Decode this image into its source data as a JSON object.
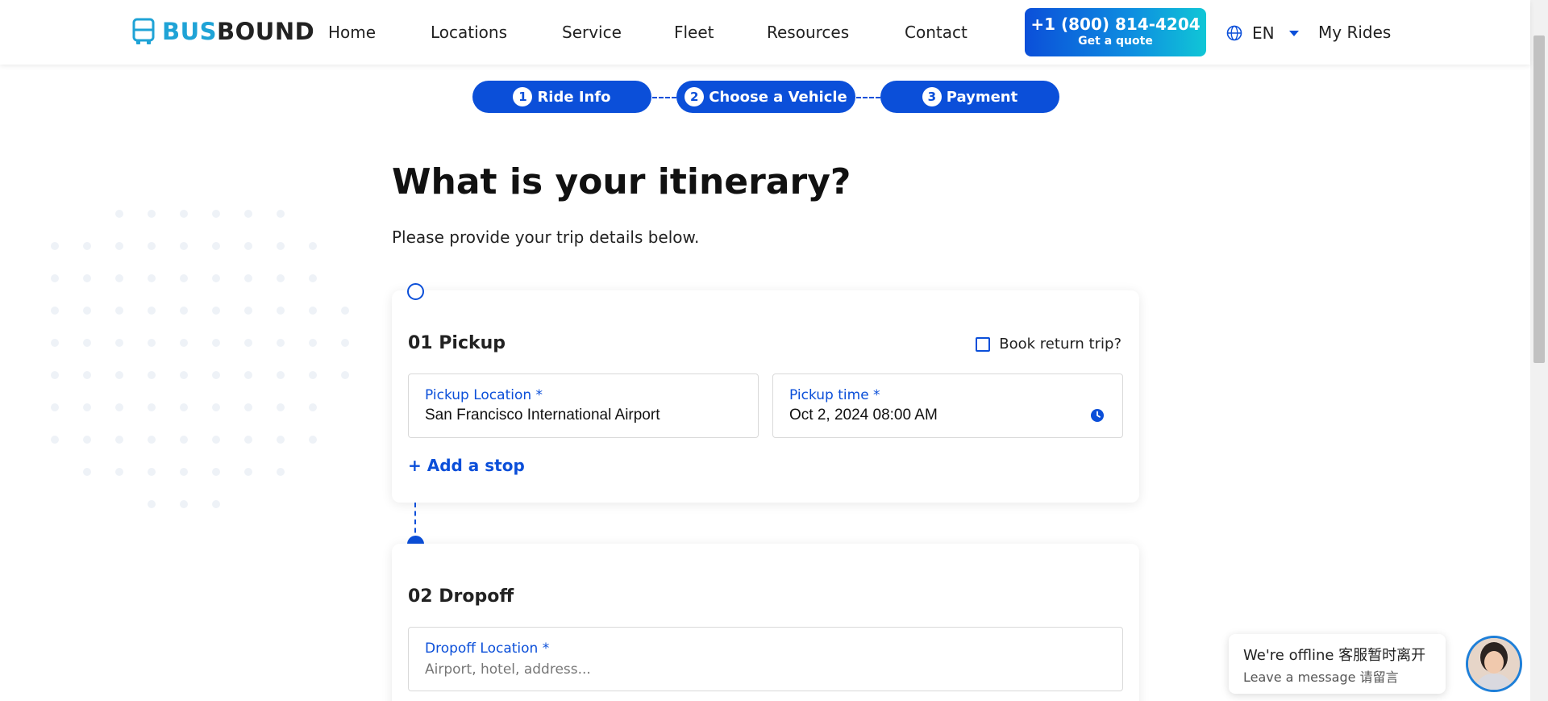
{
  "header": {
    "logo": {
      "part1": "BUS",
      "part2": "BOUND"
    },
    "nav": [
      "Home",
      "Locations",
      "Service",
      "Fleet",
      "Resources",
      "Contact"
    ],
    "cta": {
      "phone": "+1 (800) 814-4204",
      "sub": "Get a quote"
    },
    "language": "EN",
    "my_rides": "My Rides"
  },
  "steps": [
    {
      "num": "1",
      "label": "Ride Info"
    },
    {
      "num": "2",
      "label": "Choose a Vehicle"
    },
    {
      "num": "3",
      "label": "Payment"
    }
  ],
  "page": {
    "title": "What is your itinerary?",
    "subtitle": "Please provide your trip details below."
  },
  "pickup": {
    "title": "01 Pickup",
    "return_label": "Book return trip?",
    "location_label": "Pickup Location *",
    "location_value": "San Francisco International Airport",
    "time_label": "Pickup time *",
    "time_value": "Oct 2, 2024 08:00 AM",
    "add_stop": "+ Add a stop"
  },
  "dropoff": {
    "title": "02 Dropoff",
    "location_label": "Dropoff Location *",
    "location_placeholder": "Airport, hotel, address..."
  },
  "chat": {
    "title": "We're offline 客服暂时离开",
    "sub": "Leave a message 请留言"
  },
  "colors": {
    "primary": "#0b4fd9",
    "accent": "#10c6d6"
  }
}
